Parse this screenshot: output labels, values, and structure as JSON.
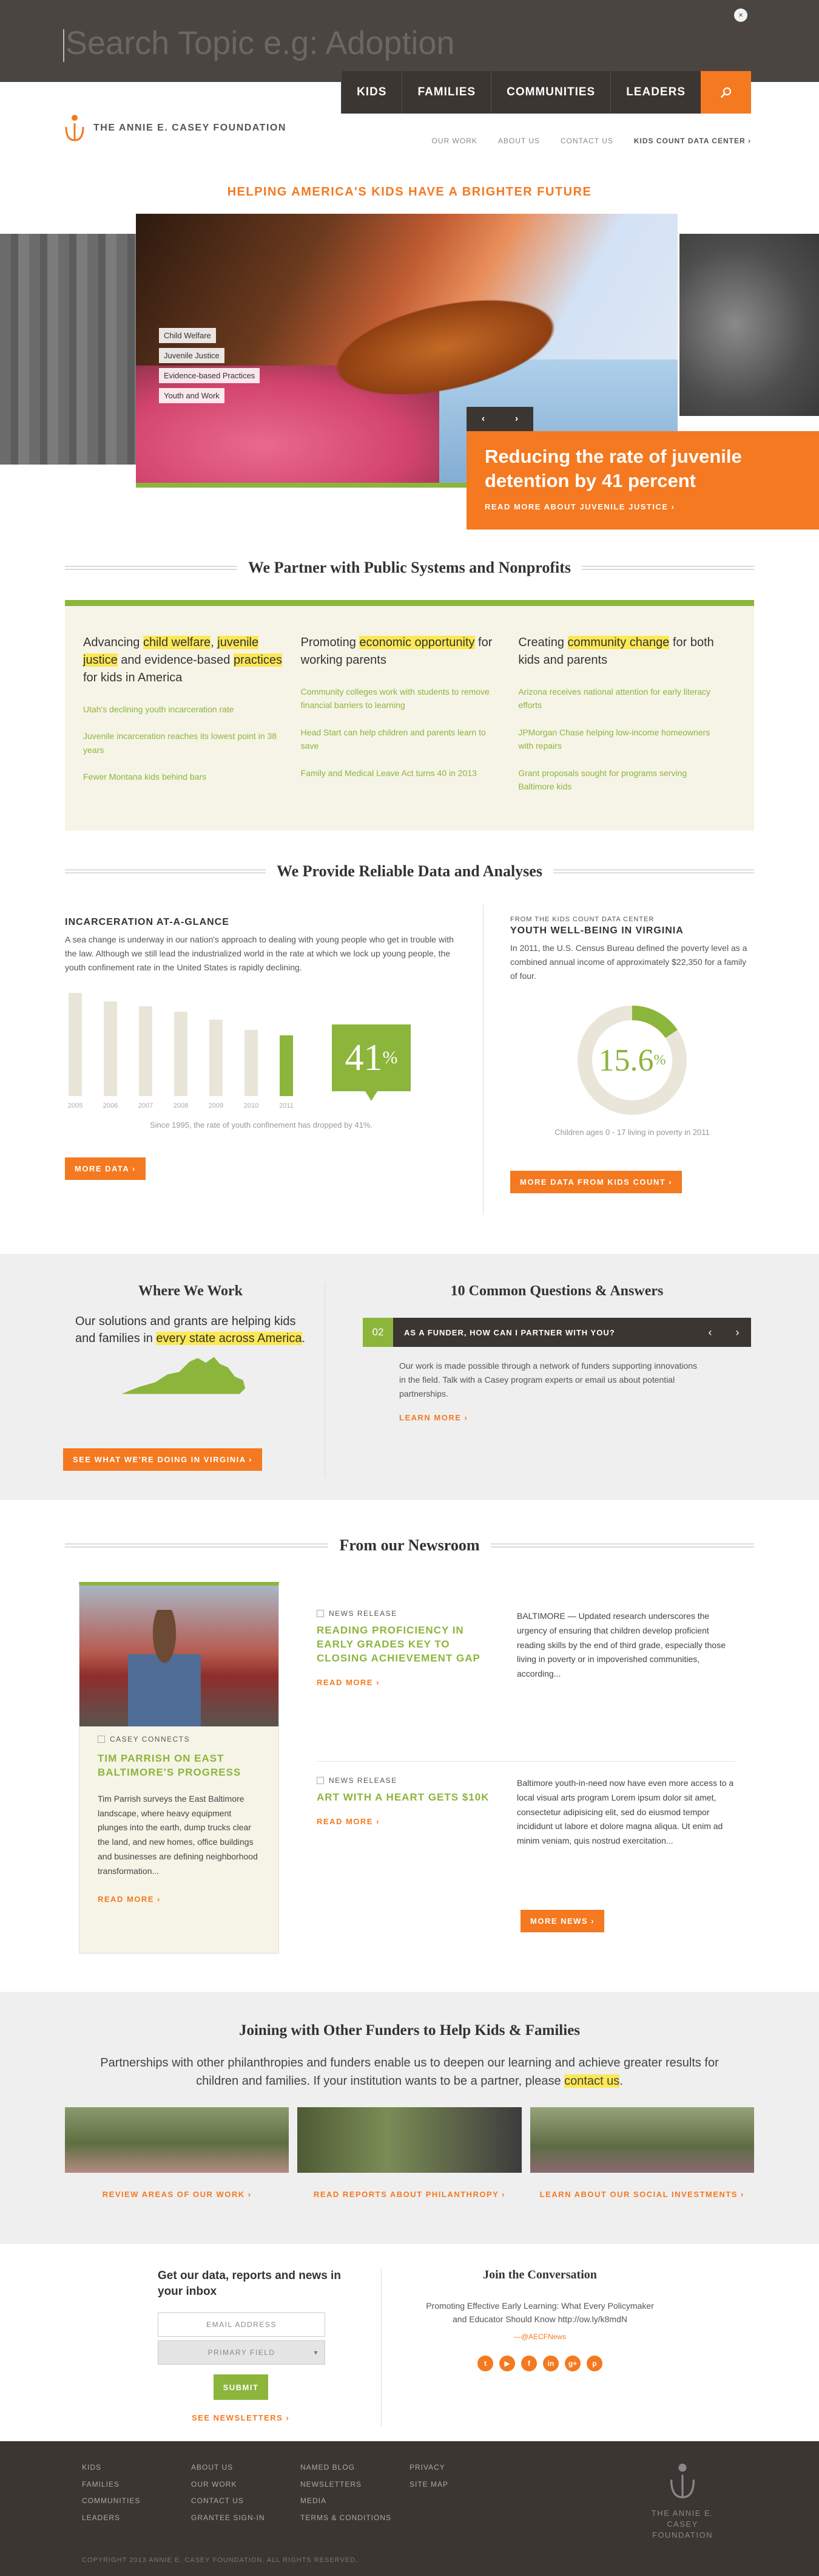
{
  "search": {
    "placeholder": "Search Topic e.g: Adoption",
    "close": "×"
  },
  "topnav": [
    "KIDS",
    "FAMILIES",
    "COMMUNITIES",
    "LEADERS"
  ],
  "logo_text": "THE ANNIE E. CASEY FOUNDATION",
  "utilnav": [
    "OUR WORK",
    "ABOUT US",
    "CONTACT US",
    "KIDS COUNT DATA CENTER ›"
  ],
  "tagline": "HELPING AMERICA'S KIDS HAVE A BRIGHTER FUTURE",
  "hero": {
    "tags": [
      "Child Welfare",
      "Juvenile Justice",
      "Evidence-based Practices",
      "Youth and Work"
    ],
    "prev": "‹",
    "next": "›",
    "headline": "Reducing the rate of juvenile detention by 41 percent",
    "more": "READ MORE ABOUT JUVENILE JUSTICE ›"
  },
  "partner": {
    "title": "We Partner with Public Systems and Nonprofits",
    "col1": {
      "pre": "Advancing ",
      "hl1": "child welfare",
      "mid1": ", ",
      "hl2": "juvenile justice",
      "mid2": " and evidence-based ",
      "hl3": "practices",
      "post": " for kids in America",
      "links": [
        "Utah's declining youth incarceration rate",
        "Juvenile incarceration reaches its lowest point in 38 years",
        "Fewer Montana kids behind bars"
      ]
    },
    "col2": {
      "pre": "Promoting ",
      "hl": "economic opportunity",
      "post": " for working parents",
      "links": [
        "Community colleges work with students to remove financial barriers to learning",
        "Head Start can help children and parents learn to save",
        "Family and Medical Leave Act turns 40 in 2013"
      ]
    },
    "col3": {
      "pre": "Creating ",
      "hl": "community change",
      "post": " for both kids and parents",
      "links": [
        "Arizona receives national attention for early literacy efforts",
        "JPMorgan Chase helping low-income homeowners with repairs",
        "Grant proposals sought for programs serving Baltimore kids"
      ]
    }
  },
  "data": {
    "title": "We Provide Reliable Data and Analyses",
    "left_heading": "INCARCERATION AT-A-GLANCE",
    "left_text": "A sea change is underway in our nation's approach to dealing with young people who get in trouble with the law. Although we still lead the industrialized world in the rate at which we lock up young people, the youth confinement rate in the United States is rapidly declining.",
    "pct": "41",
    "pct_sign": "%",
    "left_caption": "Since 1995, the rate of youth confinement has dropped by 41%.",
    "left_button": "MORE DATA ›",
    "right_kicker": "FROM THE KIDS COUNT DATA CENTER",
    "right_heading": "YOUTH WELL-BEING IN VIRGINIA",
    "right_text": "In 2011, the U.S. Census Bureau defined the poverty level as a combined annual income of approximately $22,350 for a family of four.",
    "donut_value": "15.6",
    "donut_sign": "%",
    "donut_fraction": 0.156,
    "right_caption": "Children ages 0 - 17 living in poverty in 2011",
    "right_button": "MORE DATA FROM KIDS COUNT ›"
  },
  "chart_data": [
    {
      "type": "bar",
      "categories": [
        "2005",
        "2006",
        "2007",
        "2008",
        "2009",
        "2010",
        "2011"
      ],
      "values": [
        100,
        92,
        87,
        82,
        74,
        64,
        59
      ],
      "highlight_category": "2011",
      "highlight_color": "#8cb53c",
      "bar_color": "#e9e6d9"
    },
    {
      "type": "pie",
      "labels": [
        "Children in poverty",
        "Other children"
      ],
      "values": [
        15.6,
        84.4
      ],
      "colors": [
        "#8cb53c",
        "#e9e6d9"
      ]
    }
  ],
  "where": {
    "title": "Where We Work",
    "pre": "Our solutions and grants are helping kids and families in ",
    "hl": "every state across America",
    "post": ".",
    "button": "SEE WHAT WE'RE DOING IN VIRGINIA ›"
  },
  "faq": {
    "title": "10 Common Questions & Answers",
    "num": "02",
    "question": "AS A FUNDER, HOW CAN I PARTNER WITH YOU?",
    "prev": "‹",
    "next": "›",
    "answer": "Our work is made possible through a network of funders supporting innovations in the field. Talk with a Casey program experts or email us about potential partnerships.",
    "learn": "LEARN MORE ›"
  },
  "news": {
    "title": "From our Newsroom",
    "card": {
      "kicker": "CASEY CONNECTS",
      "headline": "TIM PARRISH ON EAST BALTIMORE'S PROGRESS",
      "text": "Tim Parrish surveys the East Baltimore landscape, where heavy equipment plunges into the earth, dump trucks clear the land, and new homes, office buildings and businesses are defining neighborhood transformation...",
      "more": "READ MORE ›"
    },
    "items": [
      {
        "kicker": "NEWS RELEASE",
        "headline": "READING PROFICIENCY IN EARLY GRADES KEY TO CLOSING ACHIEVEMENT GAP",
        "more": "READ MORE ›",
        "text": "BALTIMORE — Updated research underscores the urgency of ensuring that children develop proficient reading skills by the end of third grade, especially those living in poverty or in impoverished communities, according..."
      },
      {
        "kicker": "NEWS RELEASE",
        "headline": "ART WITH A HEART GETS $10K",
        "more": "READ MORE ›",
        "text": "Baltimore youth-in-need now have even more access to a local visual arts program Lorem ipsum dolor sit amet, consectetur adipisicing elit, sed do eiusmod tempor incididunt ut labore et dolore magna aliqua. Ut enim ad minim veniam, quis nostrud exercitation..."
      }
    ],
    "button": "MORE NEWS ›"
  },
  "funders": {
    "title": "Joining with Other Funders to Help Kids & Families",
    "intro_pre": "Partnerships with other philanthropies and funders enable us to deepen our learning and achieve greater results for children and families. If your institution wants to be a partner, please ",
    "intro_link": "contact us",
    "intro_post": ".",
    "links": [
      "REVIEW AREAS OF OUR WORK ›",
      "READ REPORTS ABOUT PHILANTHROPY ›",
      "LEARN ABOUT OUR SOCIAL INVESTMENTS ›"
    ]
  },
  "newsletter": {
    "heading": "Get our data, reports and news in your inbox",
    "email_placeholder": "EMAIL ADDRESS",
    "primary_field": "PRIMARY FIELD",
    "submit": "SUBMIT",
    "see": "SEE NEWSLETTERS ›"
  },
  "social": {
    "heading": "Join the Conversation",
    "tweet": "Promoting Effective Early Learning: What Every Policymaker and Educator Should Know http://ow.ly/k8mdN",
    "handle": "—@AECFNews",
    "icons": [
      "t",
      "▶",
      "f",
      "in",
      "g+",
      "p"
    ]
  },
  "footer": {
    "col1": [
      "KIDS",
      "FAMILIES",
      "COMMUNITIES",
      "LEADERS"
    ],
    "col2": [
      "ABOUT US",
      "OUR WORK",
      "CONTACT US",
      "GRANTEE SIGN-IN"
    ],
    "col3": [
      "NAMED BLOG",
      "NEWSLETTERS",
      "MEDIA",
      "TERMS & CONDITIONS"
    ],
    "col4": [
      "PRIVACY",
      "SITE MAP"
    ],
    "logo_line1": "THE ANNIE E. CASEY",
    "logo_line2": "FOUNDATION",
    "copyright": "COPYRIGHT 2013 ANNIE E. CASEY FOUNDATION. ALL RIGHTS RESERVED."
  }
}
